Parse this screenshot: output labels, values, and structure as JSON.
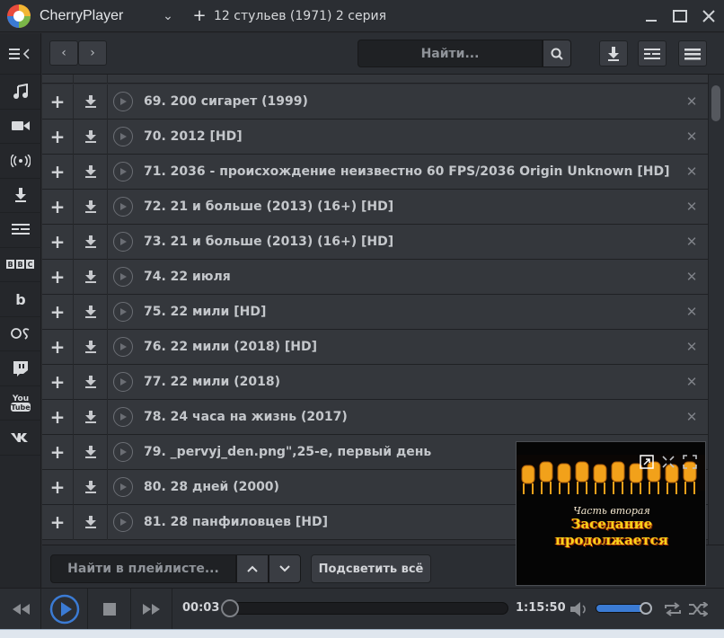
{
  "app": {
    "name": "CherryPlayer"
  },
  "tab": {
    "title": "12 стульев (1971) 2 серия"
  },
  "toolbar": {
    "search_placeholder": "Найти..."
  },
  "sidebar": {
    "items": [
      {
        "icon": "music-icon"
      },
      {
        "icon": "video-camera-icon"
      },
      {
        "icon": "radio-icon"
      },
      {
        "icon": "download-icon"
      },
      {
        "icon": "subtitles-icon"
      },
      {
        "icon": "bbc-icon",
        "label": "BBC"
      },
      {
        "icon": "bandcamp-icon",
        "label": "b"
      },
      {
        "icon": "lastfm-icon",
        "label": "OS"
      },
      {
        "icon": "twitch-icon"
      },
      {
        "icon": "youtube-icon",
        "label": "You Tube"
      },
      {
        "icon": "vk-icon",
        "label": "VK"
      }
    ]
  },
  "playlist": {
    "items": [
      {
        "title": "69. 200 сигарет (1999)"
      },
      {
        "title": "70. 2012 [HD]"
      },
      {
        "title": "71. 2036 - происхождение неизвестно 60 FPS/2036 Origin Unknown [HD]"
      },
      {
        "title": "72. 21 и больше (2013) (16+) [HD]"
      },
      {
        "title": "73. 21 и больше (2013) (16+) [HD]"
      },
      {
        "title": "74. 22 июля"
      },
      {
        "title": "75. 22 мили [HD]"
      },
      {
        "title": "76. 22 мили (2018) [HD]"
      },
      {
        "title": "77. 22 мили (2018)"
      },
      {
        "title": "78. 24 часа на жизнь (2017)"
      },
      {
        "title": "79. _pervyj_den.png\",25-е, первый день"
      },
      {
        "title": "80. 28 дней (2000)"
      },
      {
        "title": "81. 28 панфиловцев [HD]"
      }
    ],
    "search_placeholder": "Найти в плейлисте...",
    "highlight_all": "Подсветить всё"
  },
  "preview": {
    "subtitle_line1": "Часть вторая",
    "subtitle_line2": "Заседание продолжается"
  },
  "player": {
    "elapsed": "00:03",
    "duration": "1:15:50",
    "progress_fraction": 0.0007,
    "volume_fraction": 0.92
  },
  "colors": {
    "accent": "#3b7bd4",
    "background": "#2a2c30",
    "row": "#34373c"
  }
}
